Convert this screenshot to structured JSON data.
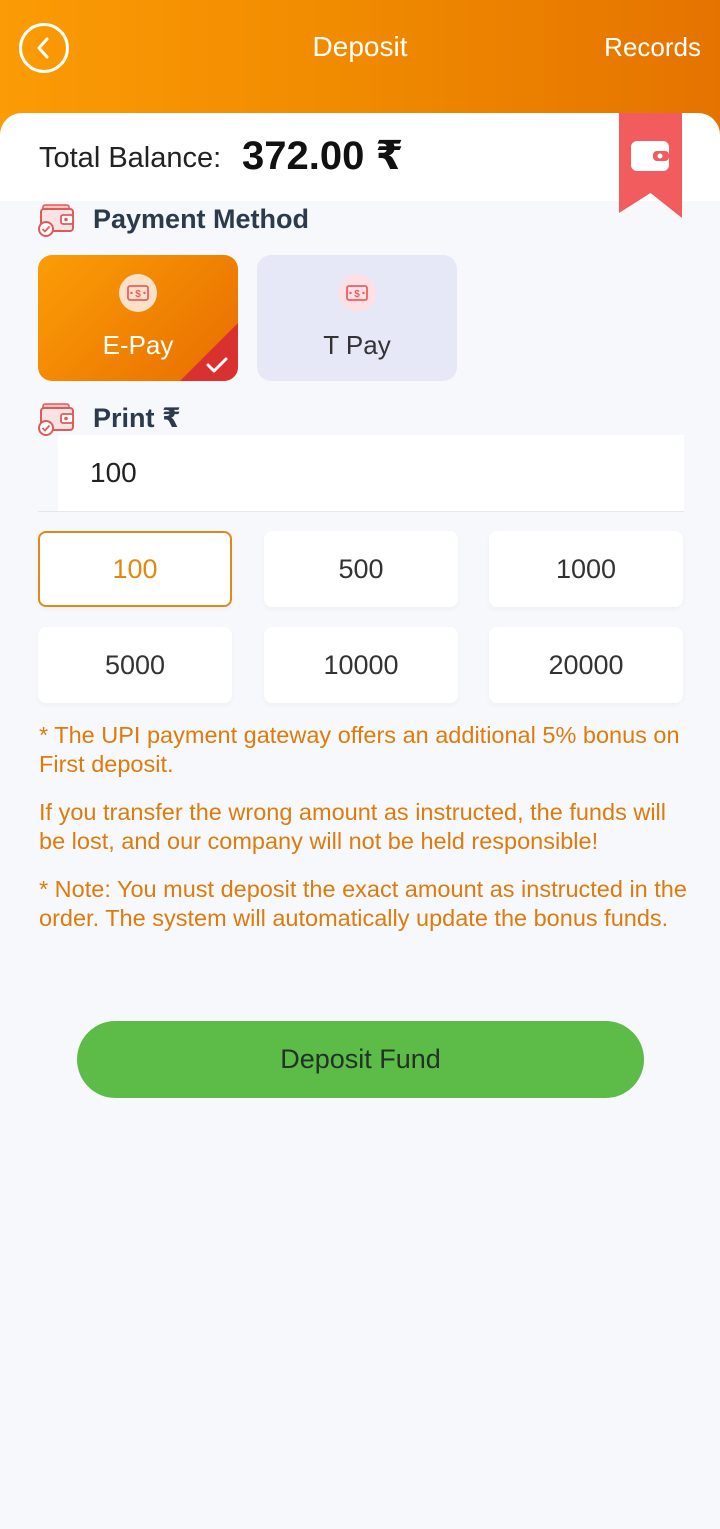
{
  "header": {
    "title": "Deposit",
    "records_label": "Records",
    "back_icon": "chevron-left-circle-icon"
  },
  "balance": {
    "label": "Total Balance:",
    "value": "372.00 ₹",
    "ribbon_icon": "wallet-icon"
  },
  "payment_method": {
    "title": "Payment Method",
    "options": [
      {
        "name": "E-Pay",
        "selected": true
      },
      {
        "name": "T Pay",
        "selected": false
      }
    ]
  },
  "amount": {
    "title": "Print ₹",
    "value": "100",
    "presets": [
      "100",
      "500",
      "1000",
      "5000",
      "10000",
      "20000"
    ],
    "selected": "100"
  },
  "notes": [
    "* The UPI payment gateway offers an additional 5% bonus on First deposit.",
    "If you transfer the wrong amount as instructed, the funds will be lost, and our company will not be held responsible!",
    "* Note: You must deposit the exact amount as instructed in the order. The system will automatically update the bonus funds."
  ],
  "deposit_button": {
    "label": "Deposit Fund"
  },
  "colors": {
    "header_orange": "#f08a00",
    "accent_orange": "#de7b0b",
    "ribbon_red": "#f25c5f",
    "button_green": "#5dbb47"
  }
}
